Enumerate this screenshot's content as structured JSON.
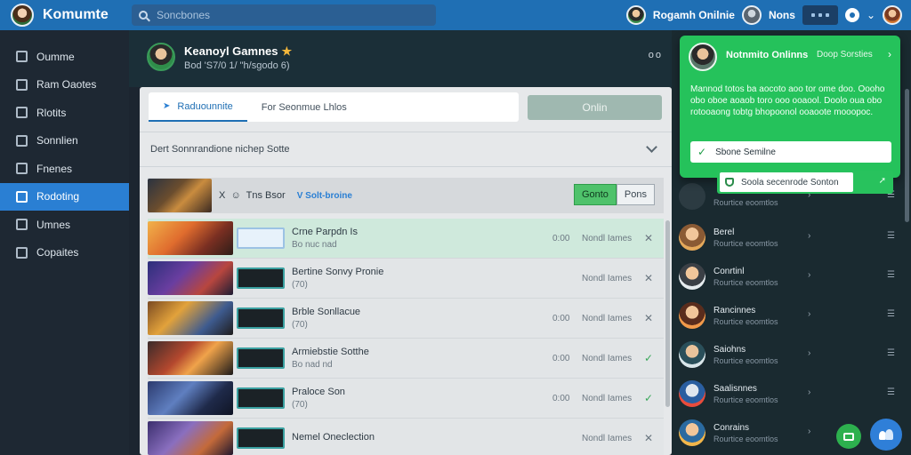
{
  "app": {
    "title": "Komumte"
  },
  "search": {
    "placeholder": "Soncbones"
  },
  "topbar": {
    "user_label": "Rogamh Onilnie",
    "nav_label": "Nons"
  },
  "sidebar": {
    "items": [
      {
        "label": "Oumme",
        "icon": "user-icon"
      },
      {
        "label": "Ram Oaotes",
        "icon": "edit-icon"
      },
      {
        "label": "Rlotits",
        "icon": "book-icon"
      },
      {
        "label": "Sonnlien",
        "icon": "list-icon"
      },
      {
        "label": "Fnenes",
        "icon": "pencil-icon"
      },
      {
        "label": "Rodoting",
        "icon": "square-icon",
        "active": true
      },
      {
        "label": "Umnes",
        "icon": "shield-icon"
      },
      {
        "label": "Copaites",
        "icon": "grid-icon"
      }
    ]
  },
  "header": {
    "title": "Keanoyl Gamnes",
    "subtitle": "Bod 'S7/0 1/ \"h/sgodo 6)",
    "right": "oo"
  },
  "tabs": [
    {
      "label": "Raduounnite",
      "active": true
    },
    {
      "label": "For Seonmue Lhlos",
      "active": false
    }
  ],
  "online_button": "Onlin",
  "filter": {
    "label": "Dert Sonnrandione nichep Sotte"
  },
  "featured": {
    "prefix": "X",
    "text": "Tns",
    "extra": "Bsor",
    "accent": "V Solt-broine",
    "btn_green": "Gonto",
    "btn_light": "Pons"
  },
  "rows": [
    {
      "name": "Crne Parpdn Is",
      "sub": "Bo nuc nad",
      "count": "0:00",
      "status": "Nondl Iames",
      "action": "x",
      "highlight": true
    },
    {
      "name": "Bertine Sonvy Pronie",
      "sub": "(70)",
      "count": "",
      "status": "Nondl Iames",
      "action": "x",
      "highlight": false
    },
    {
      "name": "Brble Sonllacue",
      "sub": "(70)",
      "count": "0:00",
      "status": "Nondl Iames",
      "action": "x",
      "highlight": false
    },
    {
      "name": "Armiebstie Sotthe",
      "sub": "Bo nad nd",
      "count": "0:00",
      "status": "Nondl Iames",
      "action": "check",
      "highlight": false
    },
    {
      "name": "Praloce Son",
      "sub": "(70)",
      "count": "0:00",
      "status": "Nondl Iames",
      "action": "check",
      "highlight": false
    },
    {
      "name": "Nemel Oneclection",
      "sub": "",
      "count": "",
      "status": "Nondl Iames",
      "action": "x",
      "highlight": false
    }
  ],
  "notification": {
    "title": "Notnmito Onlinns",
    "action": "Doop Sorsties",
    "body": "Mannod totos ba aocoto aoo tor ome doo. Oooho obo oboe aoaob toro ooo ooaool. Doolo oua obo rotooaong tobtg bhopoonol ooaoote mooopoc.",
    "check_label": "Sbone Semilne"
  },
  "send": {
    "label": "Soola secenrode Sonton"
  },
  "friends": [
    {
      "name": "",
      "sub": "Rourtice eoomtlos"
    },
    {
      "name": "Berel",
      "sub": "Rourtice eoomtlos"
    },
    {
      "name": "Conrtinl",
      "sub": "Rourtice eoomtlos"
    },
    {
      "name": "Rancinnes",
      "sub": "Rourtice eoomtlos"
    },
    {
      "name": "Saiohns",
      "sub": "Rourtice eoomtlos"
    },
    {
      "name": "Saalisnnes",
      "sub": "Rourtice eoomtlos"
    },
    {
      "name": "Conrains",
      "sub": "Rourtice eoomtlos"
    }
  ],
  "colors": {
    "accent": "#2a7fd3",
    "green": "#25c25b",
    "topbar": "#1f6fb4"
  }
}
